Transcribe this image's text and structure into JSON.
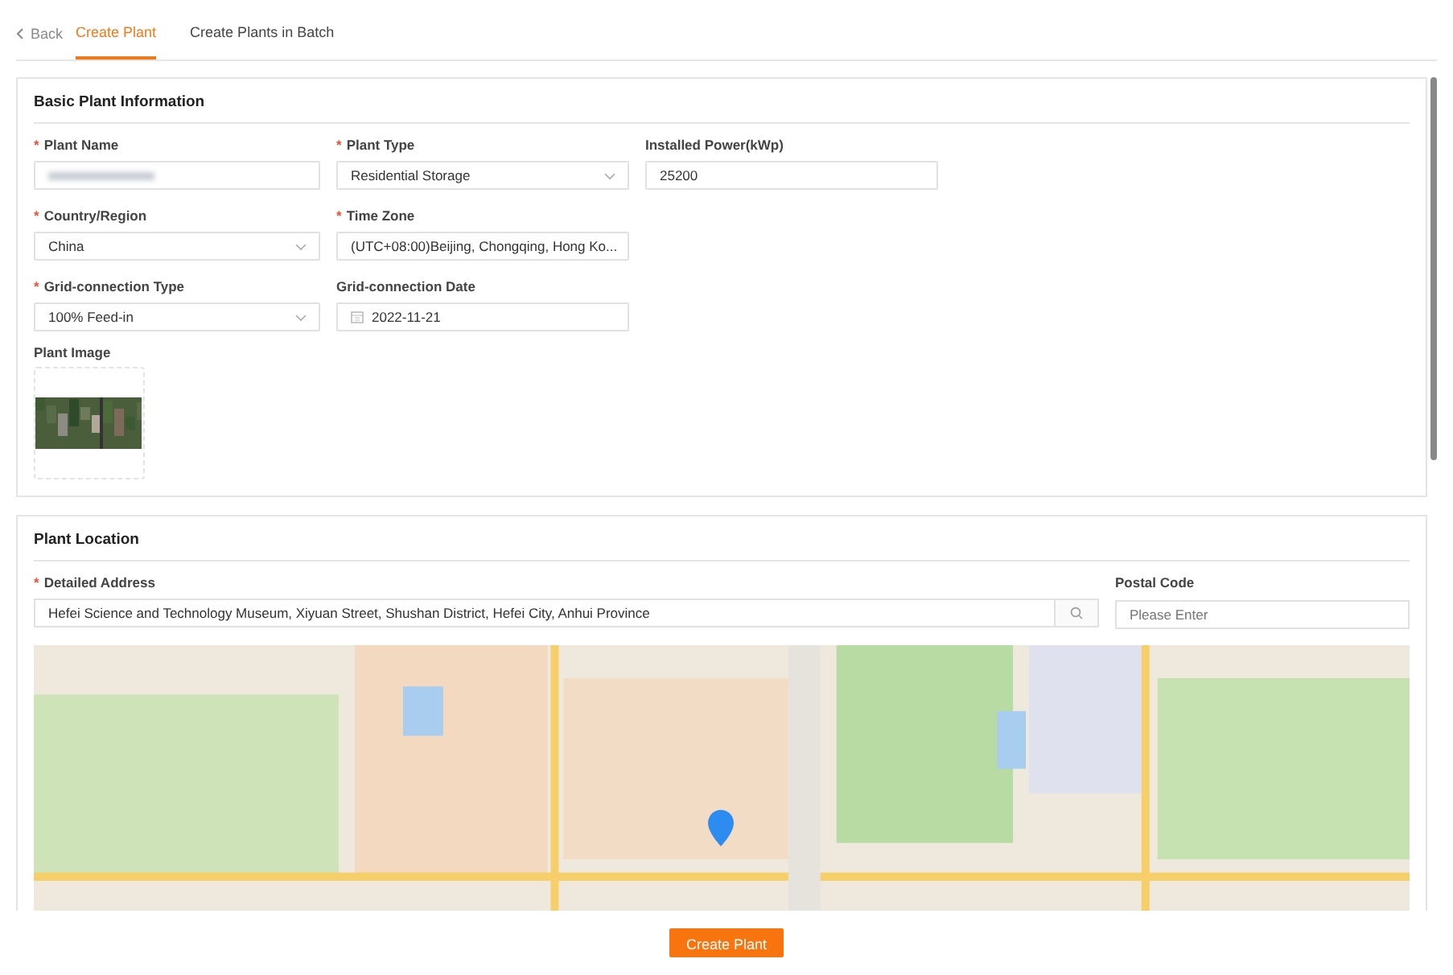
{
  "nav": {
    "back": "Back",
    "tabs": [
      {
        "label": "Create Plant",
        "selected": true
      },
      {
        "label": "Create Plants in Batch",
        "selected": false
      }
    ]
  },
  "basic": {
    "title": "Basic Plant Information",
    "rows": [
      [
        {
          "label": "Plant Name",
          "required_mark": "*",
          "kind": "blurred"
        },
        {
          "label": "Plant Type",
          "required_mark": "*",
          "kind": "select",
          "value": "Residential Storage"
        },
        {
          "label": "Installed Power(kWp)",
          "kind": "text",
          "value": "25200"
        }
      ],
      [
        {
          "label": "Country/Region",
          "required_mark": "*",
          "kind": "select",
          "value": "China"
        },
        {
          "label": "Time Zone",
          "required_mark": "*",
          "kind": "select",
          "value": "(UTC+08:00)Beijing, Chongqing, Hong Ko..."
        }
      ],
      [
        {
          "label": "Grid-connection Type",
          "required_mark": "*",
          "kind": "select",
          "value": "100% Feed-in"
        },
        {
          "label": "Grid-connection Date",
          "kind": "date",
          "value": "2022-11-21"
        }
      ]
    ],
    "image": {
      "label": "Plant Image",
      "kind": "picture"
    }
  },
  "location": {
    "title": "Plant Location",
    "address": {
      "label": "Detailed Address",
      "required_mark": "*",
      "value": "Hefei Science and Technology Museum, Xiyuan Street, Shushan District, Hefei City, Anhui Province"
    },
    "postal": {
      "label": "Postal Code",
      "placeholder": "Please Enter"
    }
  },
  "submit": "Create Plant"
}
